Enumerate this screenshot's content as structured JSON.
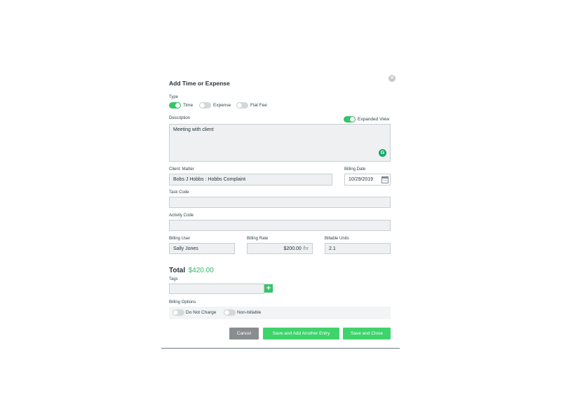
{
  "dialog": {
    "title": "Add Time or Expense",
    "close_icon": "close-icon"
  },
  "type": {
    "label": "Type",
    "options": [
      {
        "label": "Time",
        "on": true
      },
      {
        "label": "Expense",
        "on": false
      },
      {
        "label": "Flat Fee",
        "on": false
      }
    ]
  },
  "description": {
    "label": "Description",
    "value": "Meeting with client",
    "expanded_view_label": "Expanded View",
    "expanded_view_on": true
  },
  "client_matter": {
    "label": "Client: Matter",
    "value": "Bobs J Hobbs : Hobbs Complaint"
  },
  "billing_date": {
    "label": "Billing Date",
    "value": "10/29/2019"
  },
  "task_code": {
    "label": "Task Code",
    "value": ""
  },
  "activity_code": {
    "label": "Activity Code",
    "value": ""
  },
  "billing_user": {
    "label": "Billing User",
    "value": "Sally Jones"
  },
  "billing_rate": {
    "label": "Billing Rate",
    "value": "$200.00",
    "unit": "/hr"
  },
  "billable_units": {
    "label": "Billable Units",
    "value": "2.1"
  },
  "total": {
    "label": "Total",
    "value": "$420.00"
  },
  "tags": {
    "label": "Tags",
    "value": "",
    "add_symbol": "+"
  },
  "billing_options": {
    "label": "Billing Options",
    "options": [
      {
        "label": "Do Not Charge",
        "on": false
      },
      {
        "label": "Non-billable",
        "on": false
      }
    ]
  },
  "buttons": {
    "cancel": "Cancel",
    "save_add_another": "Save and Add Another Entry",
    "save_close": "Save and Close"
  },
  "colors": {
    "accent_green": "#35c46a",
    "button_green": "#3fd36b",
    "cancel_gray": "#8a8d8f",
    "text_dark": "#24343b"
  }
}
